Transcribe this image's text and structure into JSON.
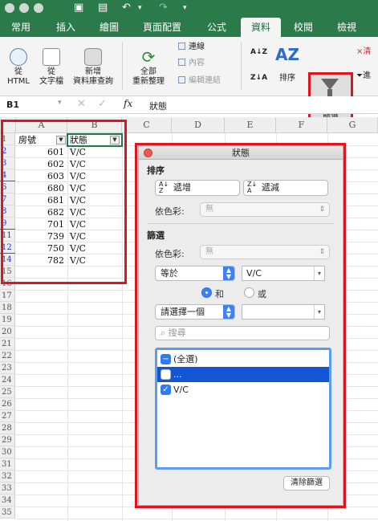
{
  "ribbon_tabs": [
    "常用",
    "插入",
    "繪圖",
    "頁面配置",
    "公式",
    "資料",
    "校閱",
    "檢視"
  ],
  "ribbon": {
    "from_html": [
      "從",
      "HTML"
    ],
    "from_text": [
      "從",
      "文字檔"
    ],
    "new_db_query": [
      "新增",
      "資料庫查詢"
    ],
    "refresh_all": [
      "全部",
      "重新整理"
    ],
    "connections": "連線",
    "properties": "內容",
    "edit_links": "編輯連結",
    "sort": "排序",
    "filter": "篩選",
    "clear_partial": "清",
    "reapply_partial": "進"
  },
  "formula_bar": {
    "name_box": "B1",
    "fx": "fx",
    "content": "狀態"
  },
  "sheet": {
    "columns": [
      "A",
      "B",
      "C",
      "D",
      "E",
      "F",
      "G"
    ],
    "rows": [
      "1",
      "2",
      "3",
      "4",
      "6",
      "7",
      "8",
      "9",
      "11",
      "12",
      "14",
      "15",
      "16",
      "17",
      "18",
      "19",
      "20",
      "21",
      "22",
      "23",
      "24",
      "25",
      "26",
      "27",
      "28",
      "29",
      "30",
      "31",
      "32",
      "33",
      "34",
      "35"
    ],
    "header_a": "房號",
    "header_b": "狀態",
    "data_a": [
      "601",
      "602",
      "603",
      "680",
      "681",
      "682",
      "701",
      "739",
      "750",
      "782"
    ],
    "data_b": [
      "V/C",
      "V/C",
      "V/C",
      "V/C",
      "V/C",
      "V/C",
      "V/C",
      "V/C",
      "V/C",
      "V/C"
    ]
  },
  "dialog": {
    "title": "狀態",
    "sort_section": "排序",
    "asc": "遞增",
    "desc": "遞減",
    "by_color_label": "依色彩:",
    "by_color_value": "無",
    "filter_section": "篩選",
    "filter_color_label": "依色彩:",
    "filter_color_value": "無",
    "condition1": "等於",
    "value1": "V/C",
    "and_label": "和",
    "or_label": "或",
    "condition2": "請選擇一個",
    "value2": "",
    "search_placeholder": "搜尋",
    "list_items": [
      "(全選)",
      "...",
      "V/C"
    ],
    "clear_filter": "清除篩選"
  }
}
